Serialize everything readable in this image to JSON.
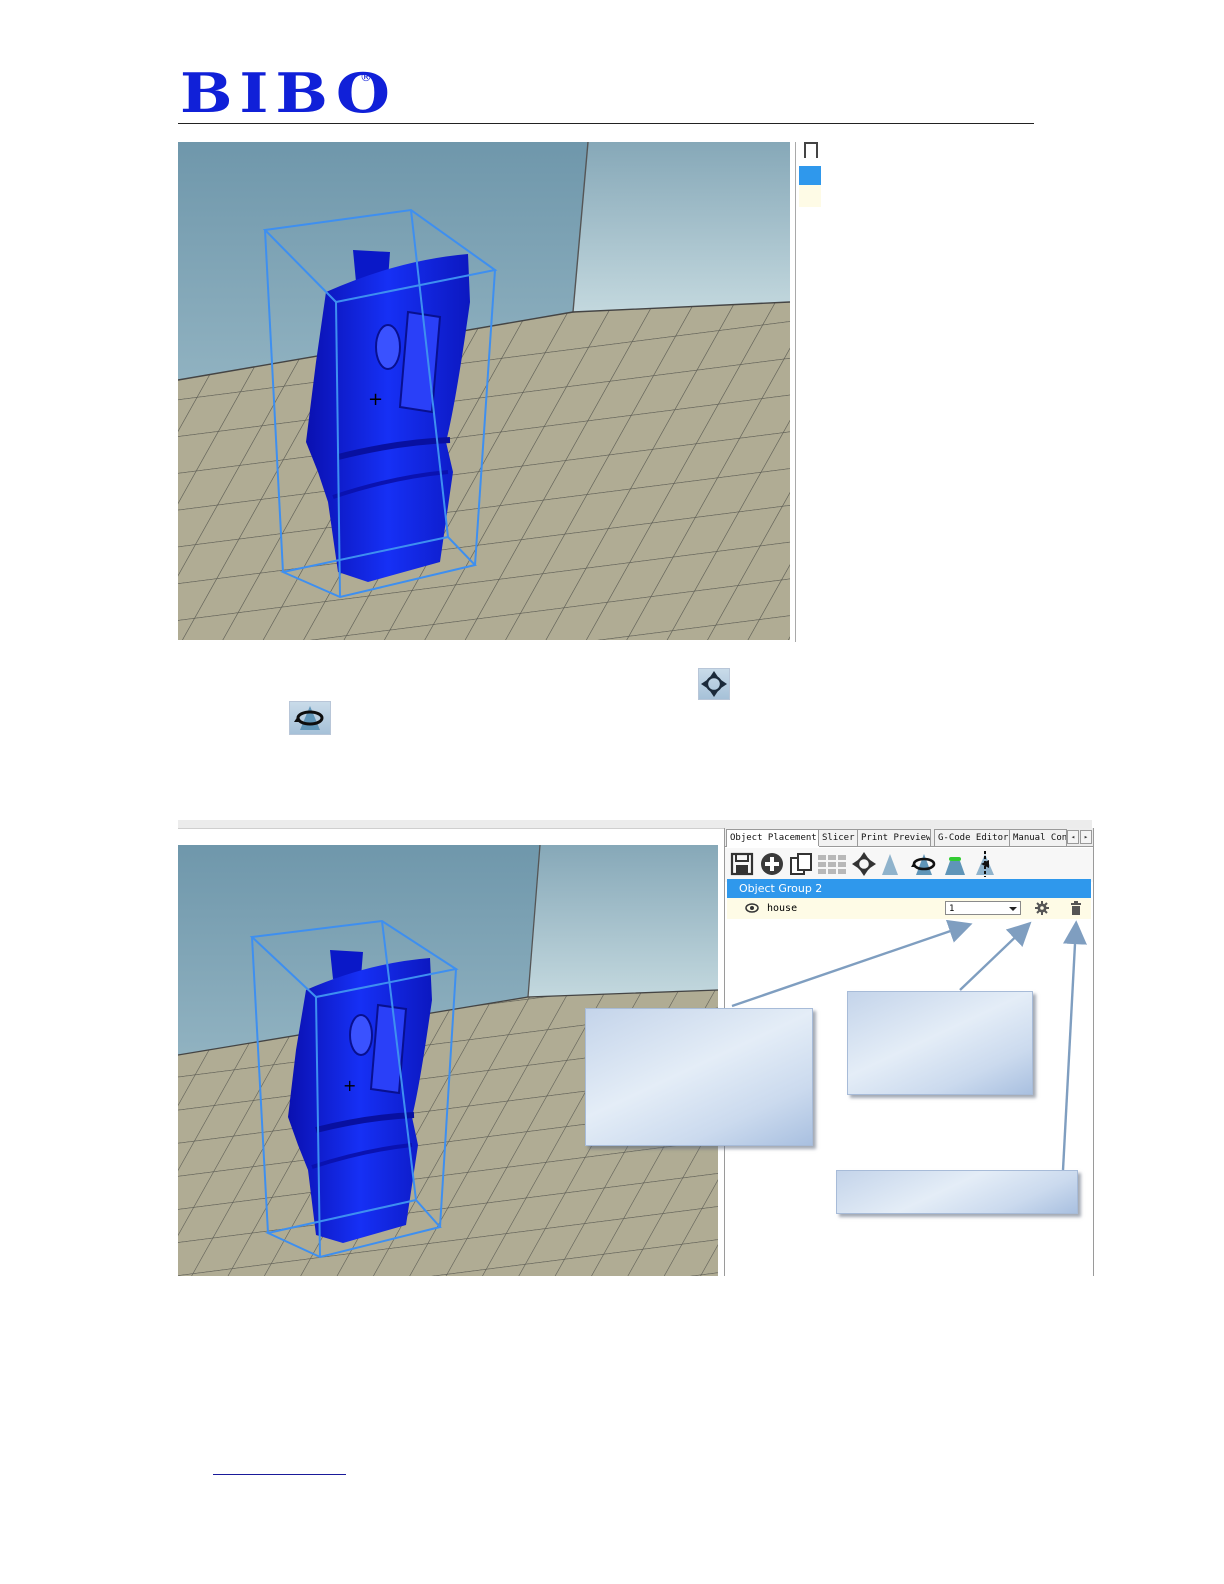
{
  "header": {
    "logo_text": "BIBO",
    "logo_mark": "®"
  },
  "colors": {
    "brand_blue": "#1020d8",
    "model_blue": "#0a1ee8",
    "bbox_blue": "#3e8ff0",
    "selection_blue": "#2f98ec"
  },
  "app": {
    "tabs": [
      {
        "label": "Object Placement",
        "active": true
      },
      {
        "label": "Slicer",
        "active": false
      },
      {
        "label": "Print Preview",
        "active": false
      },
      {
        "label": "G-Code Editor",
        "active": false
      },
      {
        "label": "Manual Con",
        "active": false
      }
    ],
    "tab_scroll_left": "◂",
    "tab_scroll_right": "▸",
    "toolbar_icons": [
      "save-icon",
      "add-object-icon",
      "copy-icon",
      "grid-icon",
      "center-icon",
      "mirror-icon",
      "rotate-icon",
      "drop-icon",
      "cut-icon"
    ],
    "group_label": "Object Group 2",
    "object": {
      "name": "house",
      "copies_value": "1"
    }
  }
}
